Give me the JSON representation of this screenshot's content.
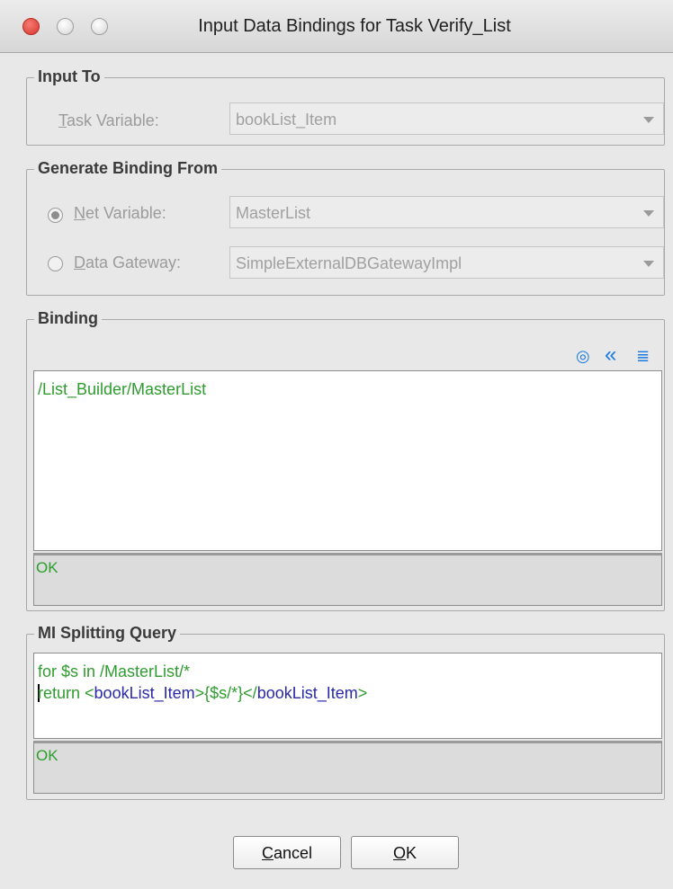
{
  "window": {
    "title": "Input Data Bindings for Task Verify_List"
  },
  "input_to": {
    "legend": "Input To",
    "task_variable_label_u": "T",
    "task_variable_label_rest": "ask Variable:",
    "task_variable_value": "bookList_Item"
  },
  "generate_binding": {
    "legend": "Generate Binding From",
    "net_variable_label_u": "N",
    "net_variable_label_rest": "et Variable:",
    "net_variable_value": "MasterList",
    "data_gateway_label_u": "D",
    "data_gateway_label_rest": "ata Gateway:",
    "data_gateway_value": "SimpleExternalDBGatewayImpl"
  },
  "binding": {
    "legend": "Binding",
    "expression": "/List_Builder/MasterList",
    "status": "OK",
    "icons": {
      "target": "◎",
      "collapse": "«",
      "format": "≣"
    }
  },
  "mi_query": {
    "legend": "MI Splitting Query",
    "line1": "for $s in /MasterList/*",
    "line2_start": "return <",
    "line2_tag1": "bookList_Item",
    "line2_mid": ">{$s/*}</",
    "line2_tag2": "bookList_Item",
    "line2_end": ">",
    "status": "OK"
  },
  "buttons": {
    "cancel_u": "C",
    "cancel_rest": "ancel",
    "ok_u": "O",
    "ok_rest": "K"
  }
}
